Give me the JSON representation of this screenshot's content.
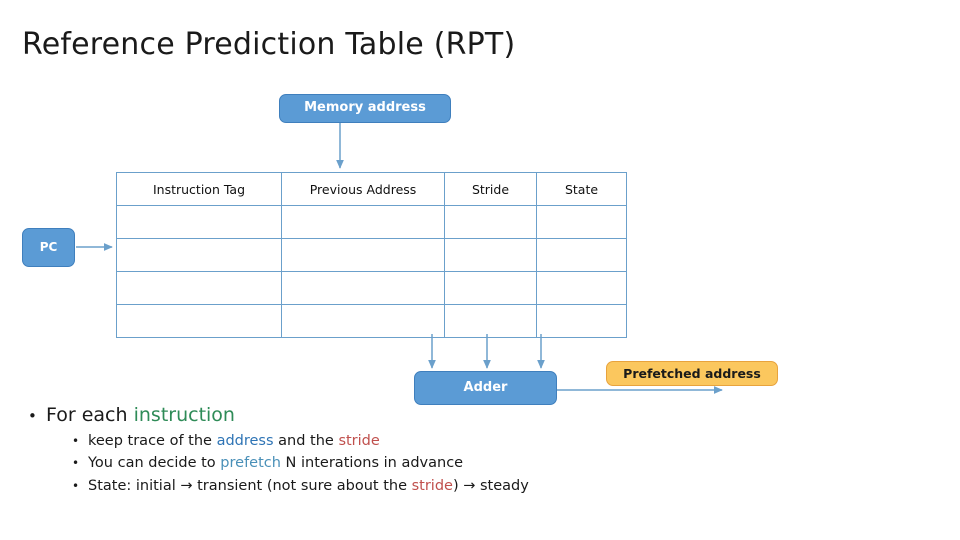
{
  "slide": {
    "title": "Reference Prediction Table (RPT)"
  },
  "diagram": {
    "memory_address_box": {
      "label": "Memory address",
      "fill": "#5b9bd5",
      "text_color": "#ffffff"
    },
    "pc_box": {
      "label": "PC",
      "fill": "#5b9bd5",
      "text_color": "#ffffff"
    },
    "adder_box": {
      "label": "Adder",
      "fill": "#5b9bd5",
      "text_color": "#ffffff"
    },
    "prefetched_box": {
      "label": "Prefetched address",
      "fill": "#fbc75e",
      "text_color": "#1a1a1a"
    },
    "connector_color": "#6ba0cb"
  },
  "table": {
    "headers": [
      "Instruction Tag",
      "Previous Address",
      "Stride",
      "State"
    ],
    "rows": [
      [
        "",
        "",
        "",
        ""
      ],
      [
        "",
        "",
        "",
        ""
      ],
      [
        "",
        "",
        "",
        ""
      ],
      [
        "",
        "",
        "",
        ""
      ]
    ],
    "border_color": "#6ba0cb"
  },
  "bullets": {
    "level1": {
      "marker": "•",
      "part1": "For each ",
      "highlight": "instruction"
    },
    "level2": [
      {
        "marker": "•",
        "segments": [
          {
            "text": "keep trace of the ",
            "color": "default"
          },
          {
            "text": "address",
            "color": "blue"
          },
          {
            "text": " and the ",
            "color": "default"
          },
          {
            "text": "stride",
            "color": "red"
          }
        ]
      },
      {
        "marker": "•",
        "segments": [
          {
            "text": "You can decide to ",
            "color": "default"
          },
          {
            "text": "prefetch",
            "color": "teal"
          },
          {
            "text": " N interations in advance",
            "color": "default"
          }
        ]
      },
      {
        "marker": "•",
        "segments": [
          {
            "text": "State: initial → transient (not sure about the ",
            "color": "default"
          },
          {
            "text": "stride",
            "color": "red"
          },
          {
            "text": ") → steady",
            "color": "default"
          }
        ]
      }
    ]
  }
}
